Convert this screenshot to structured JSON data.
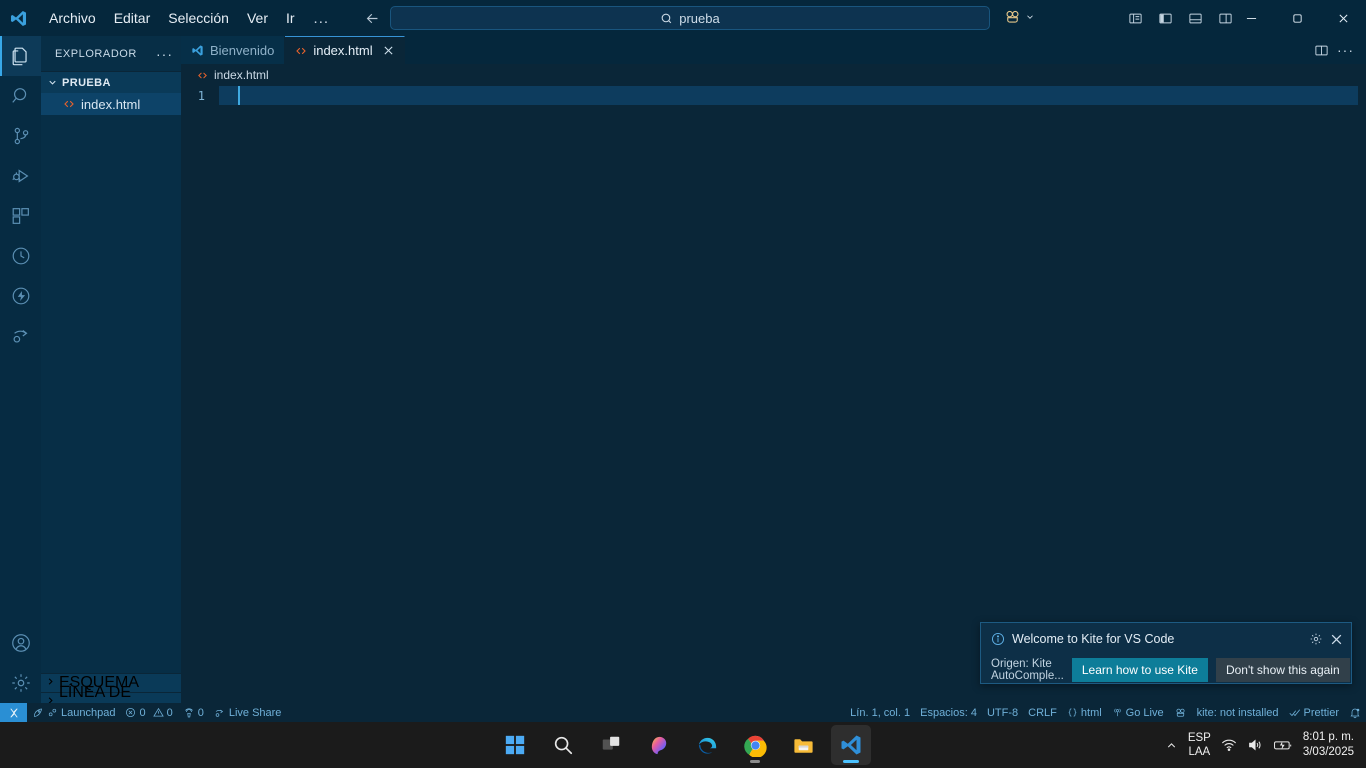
{
  "titlebar": {
    "logo_icon": "vscode-logo-icon",
    "menu": [
      {
        "label": "Archivo"
      },
      {
        "label": "Editar"
      },
      {
        "label": "Selección"
      },
      {
        "label": "Ver"
      },
      {
        "label": "Ir"
      },
      {
        "label": "..."
      }
    ],
    "nav": {
      "back_icon": "arrow-left-icon",
      "forward_icon": "arrow-right-icon"
    },
    "search": {
      "icon": "search-icon",
      "value": "prueba",
      "placeholder": "prueba"
    },
    "kite_badge": {
      "icon": "kite-icon",
      "chevron": "chevron-down-icon"
    },
    "layout_buttons": [
      {
        "name": "toggle-primary-sidebar",
        "icon": "layout-sidebar-left-icon"
      },
      {
        "name": "toggle-panel-left",
        "icon": "layout-panel-left-icon"
      },
      {
        "name": "toggle-panel-bottom",
        "icon": "layout-panel-bottom-icon"
      },
      {
        "name": "toggle-secondary-sidebar",
        "icon": "layout-sidebar-right-icon"
      }
    ],
    "window_controls": {
      "minimize": "minimize-icon",
      "maximize": "maximize-icon",
      "close": "close-icon"
    }
  },
  "activitybar": {
    "items": [
      {
        "name": "explorer",
        "icon": "files-icon",
        "active": true
      },
      {
        "name": "search",
        "icon": "search-icon",
        "active": false
      },
      {
        "name": "source-control",
        "icon": "source-control-icon",
        "active": false
      },
      {
        "name": "run-and-debug",
        "icon": "run-debug-icon",
        "active": false
      },
      {
        "name": "extensions",
        "icon": "extensions-icon",
        "active": false
      },
      {
        "name": "testing",
        "icon": "beaker-clock-icon",
        "active": false
      },
      {
        "name": "thunder-client",
        "icon": "lightning-icon",
        "active": false
      },
      {
        "name": "live-share",
        "icon": "live-share-icon",
        "active": false
      }
    ],
    "bottom": [
      {
        "name": "accounts",
        "icon": "account-icon"
      },
      {
        "name": "manage",
        "icon": "gear-icon"
      }
    ]
  },
  "sidebar": {
    "title": "EXPLORADOR",
    "more_icon": "ellipsis-icon",
    "folder": {
      "name": "PRUEBA",
      "expanded": true,
      "chevron": "chevron-down-icon"
    },
    "files": [
      {
        "name": "index.html",
        "icon": "html-file-icon",
        "selected": true
      }
    ],
    "collapsed_sections": [
      {
        "label": "ESQUEMA",
        "chevron": "chevron-right-icon"
      },
      {
        "label": "LÍNEA DE TIEMPO",
        "chevron": "chevron-right-icon"
      }
    ]
  },
  "editor": {
    "tabs": [
      {
        "label": "Bienvenido",
        "icon": "vscode-logo-icon",
        "active": false,
        "closable": false
      },
      {
        "label": "index.html",
        "icon": "html-file-icon",
        "active": true,
        "closable": true,
        "close_icon": "close-icon"
      }
    ],
    "tab_actions": [
      {
        "name": "split-editor",
        "icon": "split-editor-icon"
      },
      {
        "name": "more-actions",
        "icon": "ellipsis-icon"
      }
    ],
    "breadcrumb": {
      "icon": "html-file-icon",
      "label": "index.html"
    },
    "lines": [
      {
        "number": "1",
        "text": ""
      }
    ]
  },
  "notification": {
    "info_icon": "info-icon",
    "message": "Welcome to Kite for VS Code",
    "gear_icon": "gear-icon",
    "close_icon": "close-icon",
    "source": "Origen: Kite AutoComple...",
    "primary_button": "Learn how to use Kite",
    "secondary_button": "Don't show this again"
  },
  "statusbar": {
    "remote_icon": "remote-indicator-icon",
    "left": [
      {
        "name": "launchpad",
        "icon": "launchpad-icon",
        "label": "Launchpad"
      },
      {
        "name": "problems",
        "icon": "error-warning-icon",
        "label": "0  0",
        "errors": "0",
        "warnings": "0"
      },
      {
        "name": "ports",
        "icon": "ports-icon",
        "label": "0"
      },
      {
        "name": "live-share",
        "icon": "live-share-icon",
        "label": "Live Share"
      }
    ],
    "right": [
      {
        "name": "cursor-position",
        "label": "Lín. 1, col. 1"
      },
      {
        "name": "indentation",
        "label": "Espacios: 4"
      },
      {
        "name": "encoding",
        "label": "UTF-8"
      },
      {
        "name": "eol",
        "label": "CRLF"
      },
      {
        "name": "language-mode",
        "icon": "braces-icon",
        "label": "html"
      },
      {
        "name": "go-live",
        "icon": "broadcast-icon",
        "label": "Go Live"
      },
      {
        "name": "kite-status-icon",
        "icon": "kite-icon",
        "label": ""
      },
      {
        "name": "kite-status",
        "label": "kite: not installed"
      },
      {
        "name": "prettier",
        "icon": "check-check-icon",
        "label": "Prettier"
      },
      {
        "name": "notifications",
        "icon": "bell-dot-icon",
        "label": ""
      }
    ]
  },
  "taskbar": {
    "apps": [
      {
        "name": "start",
        "icon": "windows-start-icon",
        "running": false,
        "active": false
      },
      {
        "name": "search",
        "icon": "search-icon",
        "running": false,
        "active": false
      },
      {
        "name": "task-view",
        "icon": "task-view-icon",
        "running": false,
        "active": false
      },
      {
        "name": "copilot",
        "icon": "copilot-icon",
        "running": false,
        "active": false
      },
      {
        "name": "microsoft-edge",
        "icon": "edge-icon",
        "running": false,
        "active": false
      },
      {
        "name": "google-chrome",
        "icon": "chrome-icon",
        "running": true,
        "active": false
      },
      {
        "name": "file-explorer",
        "icon": "folder-icon",
        "running": false,
        "active": false
      },
      {
        "name": "visual-studio-code",
        "icon": "vscode-logo-icon",
        "running": true,
        "active": true
      }
    ],
    "tray": {
      "chevron_icon": "chevron-up-icon",
      "language_line1": "ESP",
      "language_line2": "LAA",
      "wifi_icon": "wifi-icon",
      "volume_icon": "volume-icon",
      "battery_icon": "battery-charging-icon",
      "time": "8:01 p. m.",
      "date": "3/03/2025"
    }
  }
}
